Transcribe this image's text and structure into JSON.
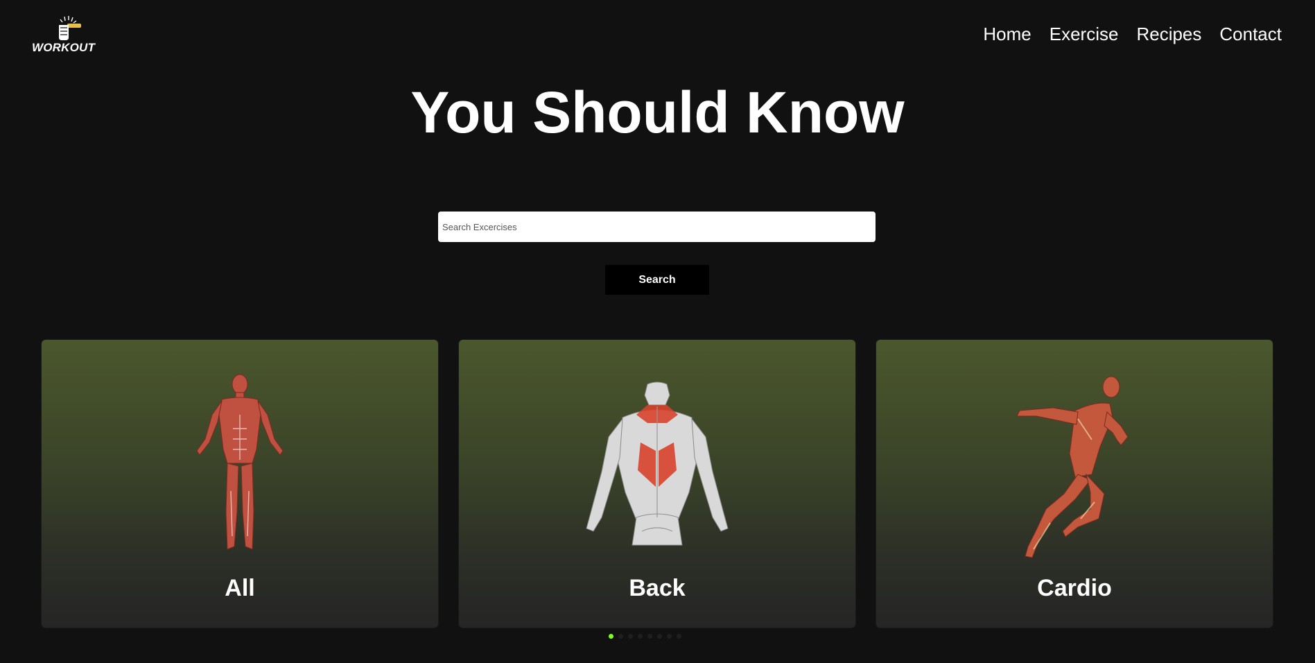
{
  "brand": {
    "logo_text": "WORKOUT",
    "logo_icon": "fist-dumbbell-icon"
  },
  "nav": {
    "items": [
      {
        "label": "Home"
      },
      {
        "label": "Exercise"
      },
      {
        "label": "Recipes"
      },
      {
        "label": "Contact"
      }
    ]
  },
  "hero": {
    "title": "You Should Know"
  },
  "search": {
    "placeholder": "Search Excercises",
    "value": "",
    "button_label": "Search"
  },
  "categories": [
    {
      "label": "All",
      "icon": "full-body-muscle-figure"
    },
    {
      "label": "Back",
      "icon": "back-muscle-figure"
    },
    {
      "label": "Cardio",
      "icon": "running-muscle-figure"
    }
  ],
  "carousel": {
    "page_count": 8,
    "active_page": 1
  },
  "colors": {
    "background": "#111111",
    "card_top": "#4b572d",
    "card_bottom": "#252525",
    "active_dot": "#7cff1f",
    "muscle": "#c0503f",
    "highlight_muscle": "#d8432c"
  }
}
